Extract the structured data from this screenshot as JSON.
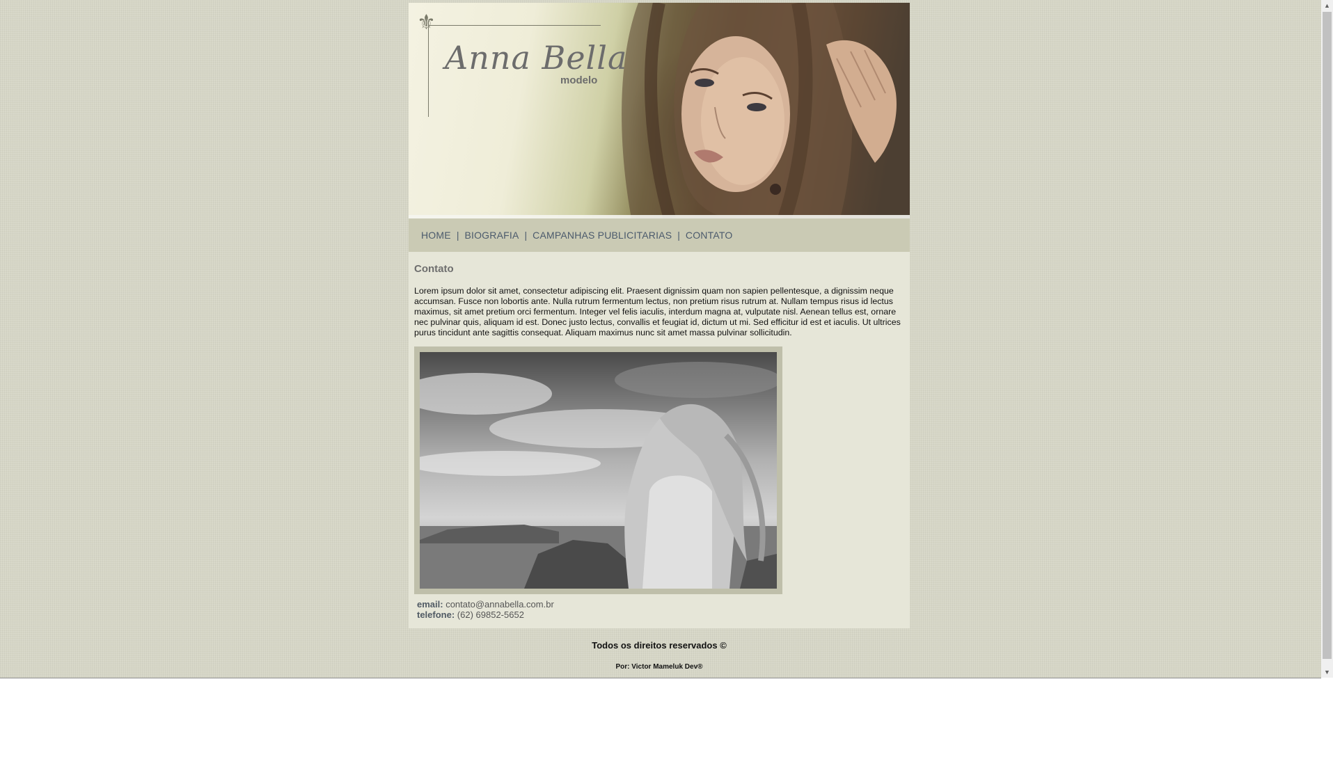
{
  "site": {
    "logo_name": "Anna Bella",
    "logo_sub": "modelo"
  },
  "nav": {
    "items": [
      {
        "label": "HOME"
      },
      {
        "label": "BIOGRAFIA"
      },
      {
        "label": "CAMPANHAS PUBLICITARIAS"
      },
      {
        "label": "CONTATO"
      }
    ],
    "separator": "|"
  },
  "content": {
    "title": "Contato",
    "body": "Lorem ipsum dolor sit amet, consectetur adipiscing elit. Praesent dignissim quam non sapien pellentesque, a dignissim neque accumsan. Fusce non lobortis ante. Nulla rutrum fermentum lectus, non pretium risus rutrum at. Nullam tempus risus id lectus maximus, sit amet pretium orci fermentum. Integer vel felis iaculis, interdum magna at, vulputate nisl. Aenean tellus est, ornare nec pulvinar quis, aliquam id est. Donec justo lectus, convallis et feugiat id, dictum ut mi. Sed efficitur id est et iaculis. Ut ultrices purus tincidunt ante sagittis consequat. Aliquam maximus nunc sit amet massa pulvinar sollicitudin.",
    "email_label": "email:",
    "email_value": "contato@annabella.com.br",
    "phone_label": "telefone:",
    "phone_value": "(62) 69852-5652"
  },
  "footer": {
    "rights": "Todos os direitos reservados ©",
    "by": "Por: Victor Mameluk Dev®"
  },
  "colors": {
    "page_bg": "#d6d6c6",
    "nav_bg": "#cacab4",
    "content_bg": "#e6e6d8",
    "nav_text": "#4b5a6c"
  }
}
